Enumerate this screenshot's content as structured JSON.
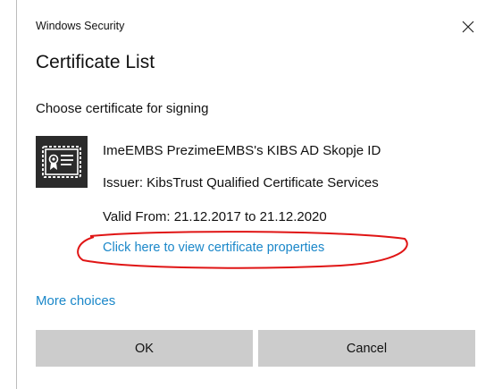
{
  "window": {
    "title": "Windows Security",
    "close_icon": "close-icon"
  },
  "dialog": {
    "heading": "Certificate List",
    "prompt": "Choose certificate for signing"
  },
  "certificate": {
    "icon": "certificate-icon",
    "subject": "ImeEMBS PrezimeEMBS's KIBS AD Skopje ID",
    "issuer": "Issuer: KibsTrust Qualified Certificate Services",
    "valid": "Valid From: 21.12.2017 to 21.12.2020",
    "properties_link": "Click here to view certificate properties"
  },
  "annotation": {
    "color": "#e01515"
  },
  "more_choices": "More choices",
  "buttons": {
    "ok": "OK",
    "cancel": "Cancel"
  },
  "colors": {
    "link": "#1a87c9",
    "button_bg": "#cccccc",
    "icon_bg": "#2b2b2b"
  }
}
